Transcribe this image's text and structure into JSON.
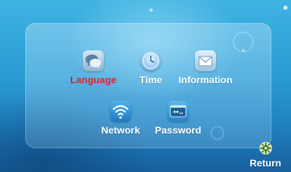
{
  "menu": {
    "items": [
      {
        "label": "Language",
        "icon": "language-icon",
        "selected": true
      },
      {
        "label": "Time",
        "icon": "clock-icon",
        "selected": false
      },
      {
        "label": "Information",
        "icon": "envelope-icon",
        "selected": false
      },
      {
        "label": "Network",
        "icon": "wifi-icon",
        "selected": false
      },
      {
        "label": "Password",
        "icon": "password-icon",
        "selected": false
      }
    ]
  },
  "footer": {
    "return_label": "Return",
    "return_icon": "gear-icon"
  },
  "colors": {
    "selected_label": "#d8262c",
    "label": "#ffffff",
    "background": "#2a9bd3"
  }
}
